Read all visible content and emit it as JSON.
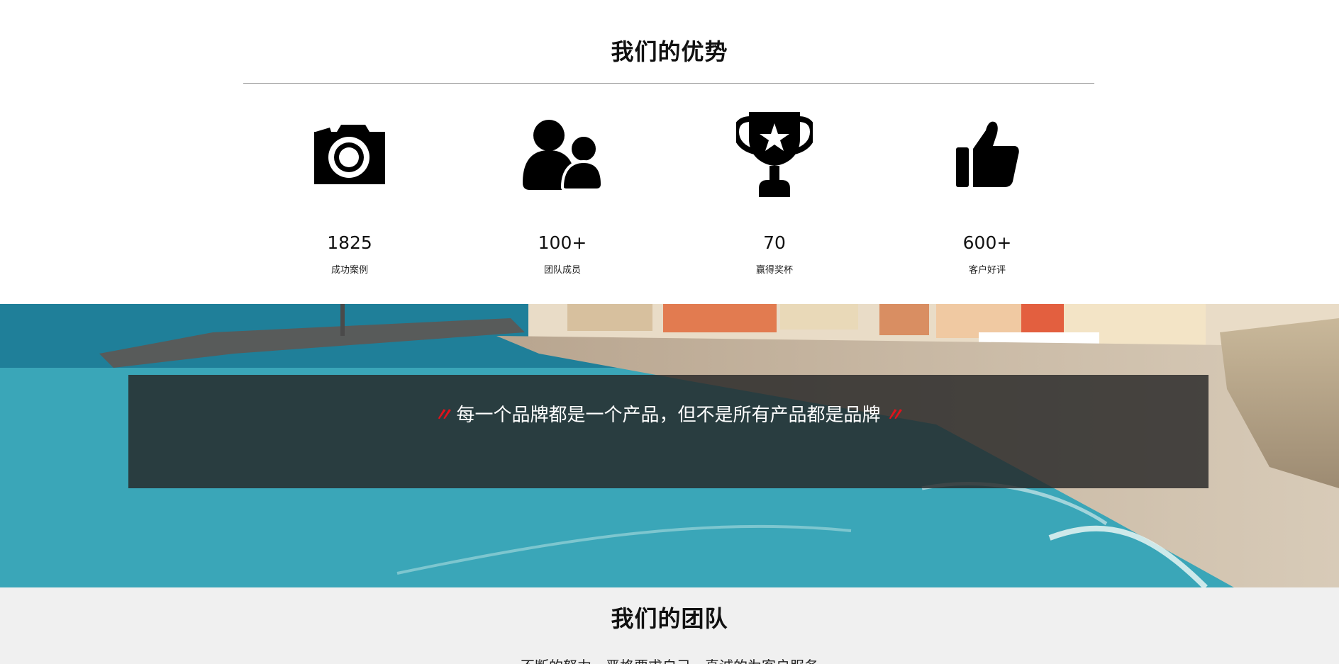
{
  "advantages": {
    "title": "我们的优势",
    "stats": [
      {
        "icon": "camera-icon",
        "value": "1825",
        "caption": "成功案例"
      },
      {
        "icon": "team-users-icon",
        "value": "100+",
        "caption": "团队成员"
      },
      {
        "icon": "trophy-icon",
        "value": "70",
        "caption": "赢得奖杯"
      },
      {
        "icon": "thumbs-up-icon",
        "value": "600+",
        "caption": "客户好评"
      }
    ]
  },
  "banner": {
    "quote": "每一个品牌都是一个产品，但不是所有产品都是品牌",
    "open_mark": "〃",
    "close_mark": "〃",
    "accent_color": "#e0121b"
  },
  "team": {
    "title": "我们的团队",
    "subtitle": "不断的努力，严格要求自己，真诚的为客户服务"
  }
}
